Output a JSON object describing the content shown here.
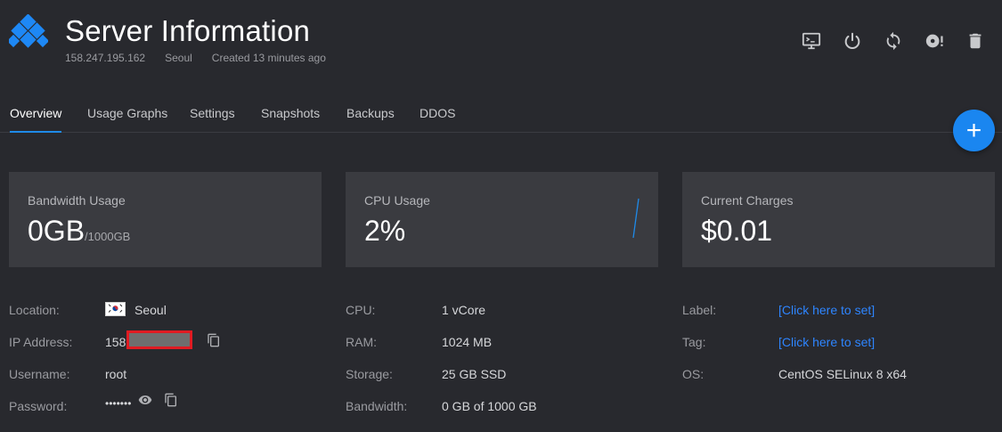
{
  "header": {
    "title": "Server Information",
    "ip": "158.247.195.162",
    "location": "Seoul",
    "created": "Created 13 minutes ago"
  },
  "actions": [
    "console-icon",
    "power-icon",
    "restart-icon",
    "iso-icon",
    "trash-icon"
  ],
  "tabs": [
    {
      "label": "Overview",
      "active": true
    },
    {
      "label": "Usage Graphs"
    },
    {
      "label": "Settings"
    },
    {
      "label": "Snapshots"
    },
    {
      "label": "Backups"
    },
    {
      "label": "DDOS"
    }
  ],
  "fab": {
    "label": "+"
  },
  "cards": {
    "bandwidth": {
      "label": "Bandwidth Usage",
      "value": "0GB",
      "unit": "/1000GB"
    },
    "cpu": {
      "label": "CPU Usage",
      "value": "2%"
    },
    "charges": {
      "label": "Current Charges",
      "value": "$0.01"
    }
  },
  "details": {
    "location": {
      "label": "Location:",
      "value": "Seoul"
    },
    "ip": {
      "label": "IP Address:",
      "value": "158"
    },
    "username": {
      "label": "Username:",
      "value": "root"
    },
    "password": {
      "label": "Password:",
      "value": "•••••••"
    },
    "cpu": {
      "label": "CPU:",
      "value": "1 vCore"
    },
    "ram": {
      "label": "RAM:",
      "value": "1024 MB"
    },
    "storage": {
      "label": "Storage:",
      "value": "25 GB SSD"
    },
    "bandwidth": {
      "label": "Bandwidth:",
      "value": "0 GB of 1000 GB"
    },
    "label": {
      "label": "Label:",
      "value": "[Click here to set]"
    },
    "tag": {
      "label": "Tag:",
      "value": "[Click here to set]"
    },
    "os": {
      "label": "OS:",
      "value": "CentOS SELinux 8 x64"
    }
  },
  "colors": {
    "background": "#28292e",
    "card": "#3a3b40",
    "accent": "#1a86f0",
    "link": "#2e85ff",
    "redaction": "#e01b22"
  }
}
